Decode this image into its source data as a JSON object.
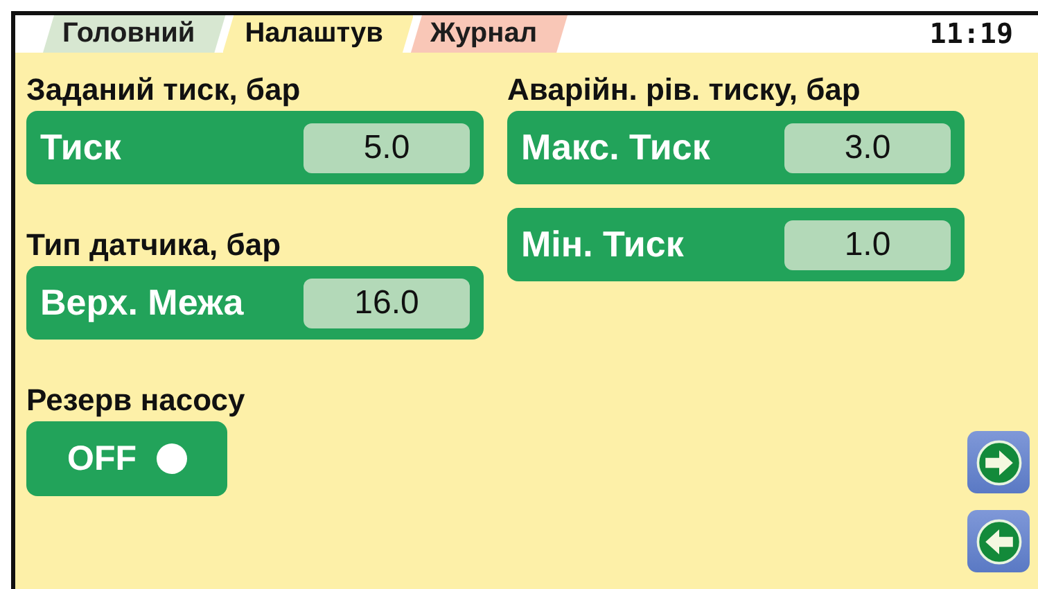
{
  "tabs": [
    {
      "label": "Головний",
      "selected": false,
      "color": "#d5e6cf"
    },
    {
      "label": "Налаштув",
      "selected": true,
      "color": "#fdf0a8"
    },
    {
      "label": "Журнал",
      "selected": false,
      "color": "#f9c4b4"
    }
  ],
  "clock": "11:19",
  "columns": [
    [
      {
        "kind": "heading",
        "text": "Заданий тиск, бар"
      },
      {
        "kind": "field",
        "label": "Тиск",
        "value": "5.0"
      },
      {
        "kind": "heading",
        "text": "Тип датчика, бар"
      },
      {
        "kind": "field",
        "label": "Верх. Межа",
        "value": "16.0"
      },
      {
        "kind": "heading",
        "text": "Резерв насосу"
      },
      {
        "kind": "toggle",
        "label": "OFF",
        "on": false
      }
    ],
    [
      {
        "kind": "heading",
        "text": "Аварійн. рів. тиску, бар"
      },
      {
        "kind": "field",
        "label": "Макс. Тиск",
        "value": "3.0"
      },
      {
        "kind": "field",
        "label": "Мін. Тиск",
        "value": "1.0"
      }
    ]
  ],
  "nav_buttons": [
    {
      "kind": "next"
    },
    {
      "kind": "back"
    }
  ]
}
